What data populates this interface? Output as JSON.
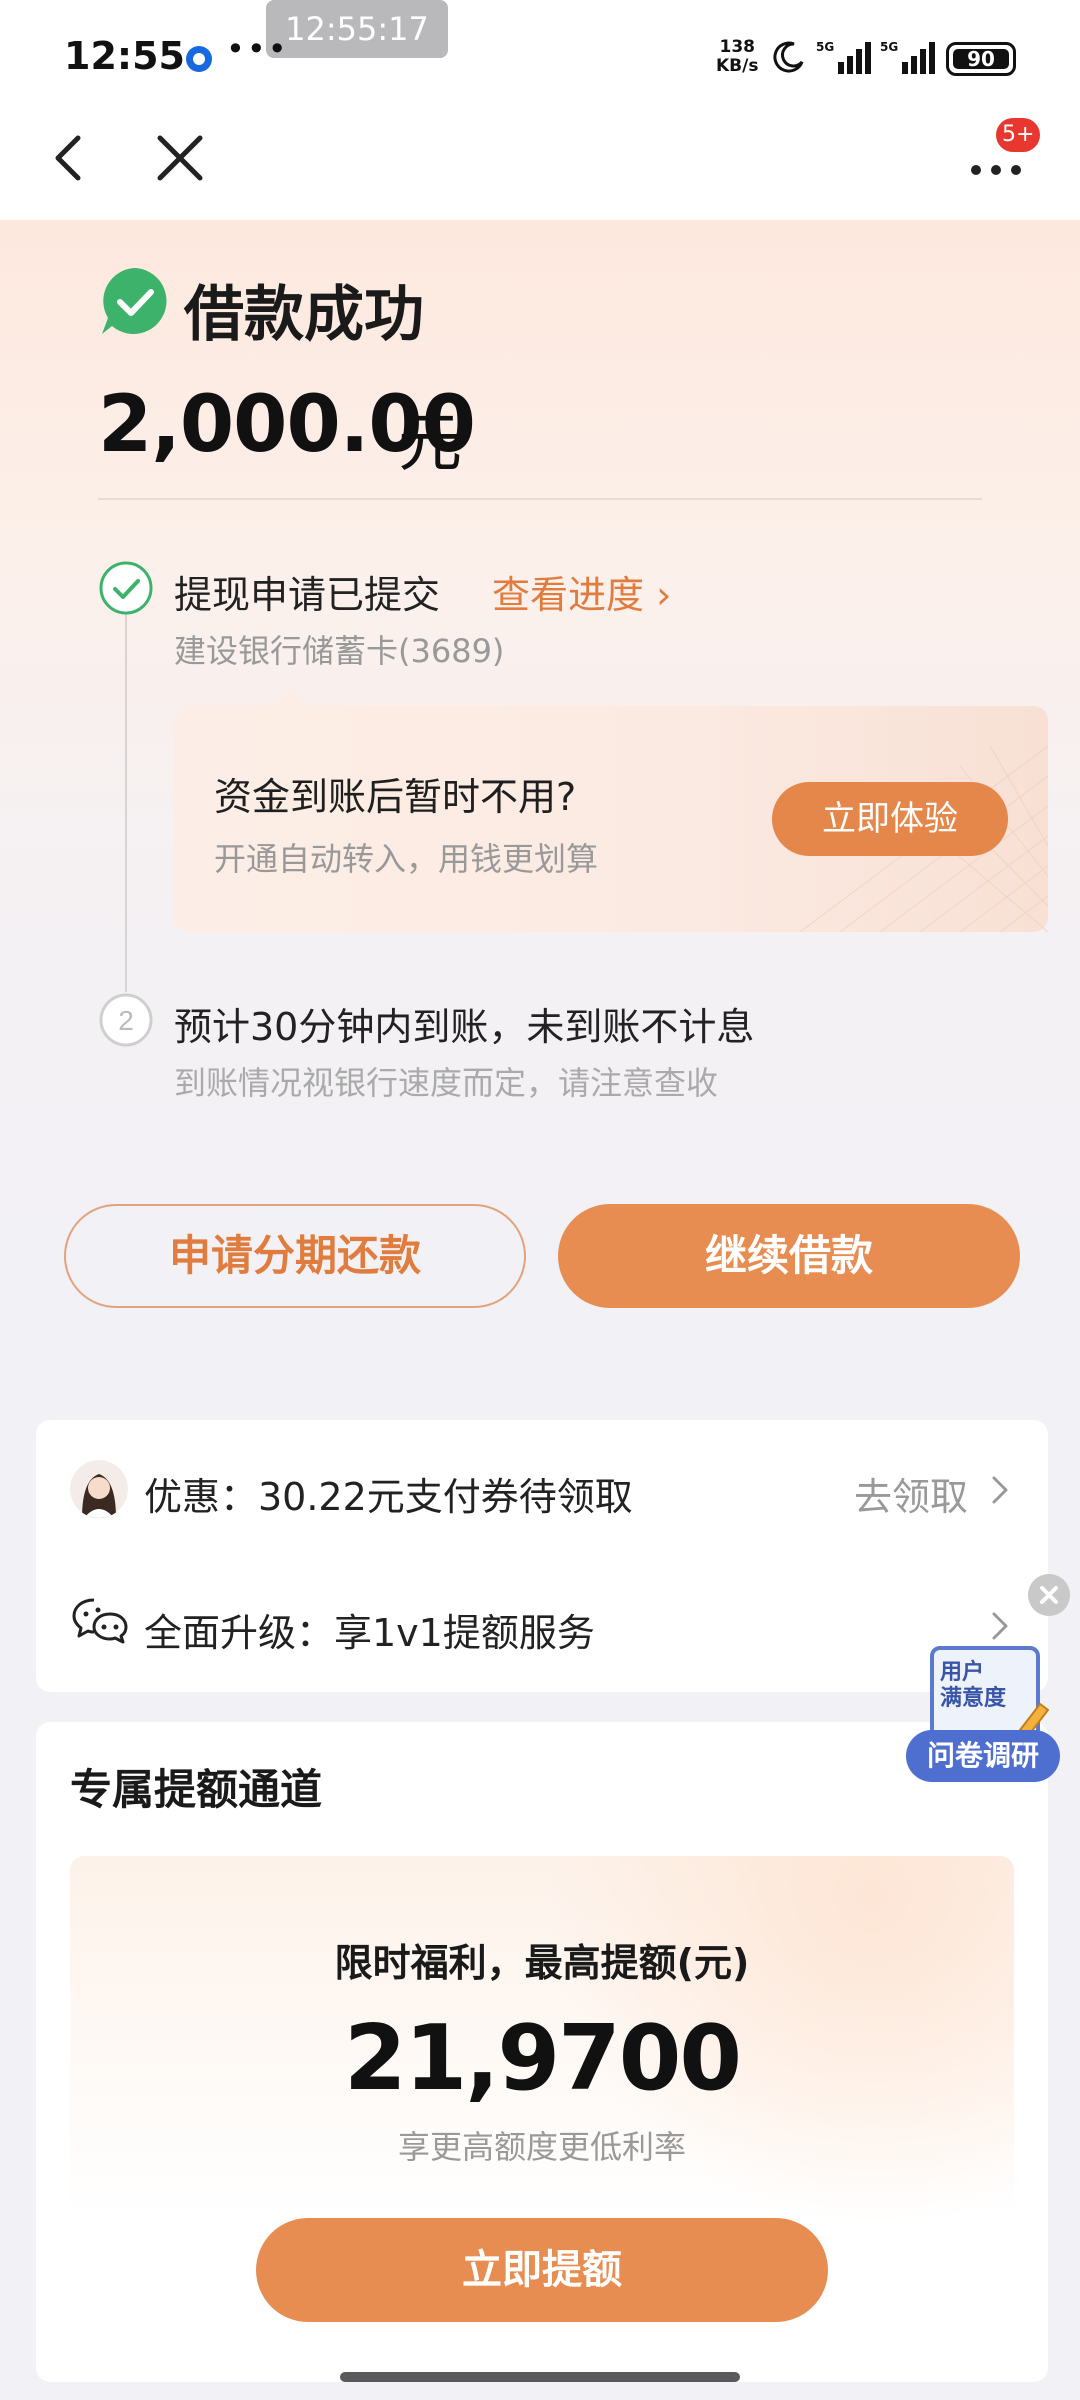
{
  "status_bar": {
    "time": "12:55",
    "screen_time": "12:55:17",
    "more": "•••",
    "net_speed_value": "138",
    "net_speed_unit": "KB/s",
    "signal_1_label": "5G",
    "signal_2_label": "5G",
    "battery": "90"
  },
  "nav": {
    "badge": "5+"
  },
  "success": {
    "title": "借款成功",
    "amount": "2,000.00",
    "unit": "元"
  },
  "steps": [
    {
      "number": "",
      "title": "提现申请已提交",
      "link": "查看进度 ›",
      "subtitle": "建设银行储蓄卡(3689)"
    },
    {
      "number": "2",
      "title": "预计30分钟内到账，未到账不计息",
      "subtitle": "到账情况视银行速度而定，请注意查收"
    }
  ],
  "promo": {
    "title": "资金到账后暂时不用?",
    "subtitle": "开通自动转入，用钱更划算",
    "button": "立即体验"
  },
  "actions": {
    "installment": "申请分期还款",
    "continue": "继续借款"
  },
  "offers": {
    "coupon_text": "优惠：30.22元支付券待领取",
    "coupon_action": "去领取",
    "upgrade_text": "全面升级：享1v1提额服务"
  },
  "survey": {
    "clip_line1": "用户",
    "clip_line2": "满意度",
    "label": "问卷调研"
  },
  "exclusive": {
    "title": "专属提额通道",
    "heading": "限时福利，最高提额(元)",
    "amount": "21,9700",
    "subtitle": "享更高额度更低利率",
    "button": "立即提额"
  },
  "colors": {
    "accent": "#e78d52",
    "accent_text": "#e07c3e",
    "success_green": "#3cb26b",
    "survey_blue": "#4f6fd0",
    "badge_red": "#e8372f"
  }
}
